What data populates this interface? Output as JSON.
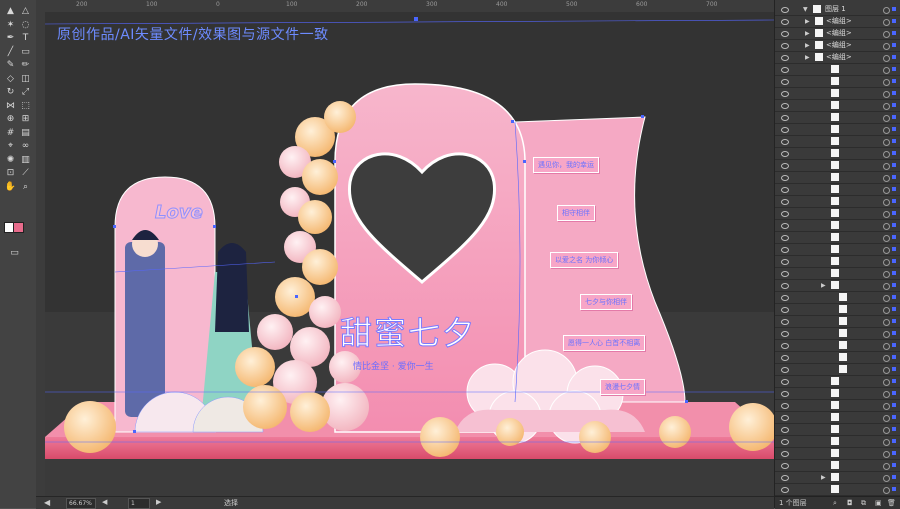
{
  "toolbar": {
    "tools": [
      {
        "name": "selection-tool",
        "glyph": "▲"
      },
      {
        "name": "direct-selection-tool",
        "glyph": "△"
      },
      {
        "name": "magic-wand-tool",
        "glyph": "✶"
      },
      {
        "name": "lasso-tool",
        "glyph": "◌"
      },
      {
        "name": "pen-tool",
        "glyph": "✒"
      },
      {
        "name": "type-tool",
        "glyph": "T"
      },
      {
        "name": "line-tool",
        "glyph": "╱"
      },
      {
        "name": "rectangle-tool",
        "glyph": "▭"
      },
      {
        "name": "paintbrush-tool",
        "glyph": "✎"
      },
      {
        "name": "pencil-tool",
        "glyph": "✏"
      },
      {
        "name": "shaper-tool",
        "glyph": "◇"
      },
      {
        "name": "eraser-tool",
        "glyph": "◫"
      },
      {
        "name": "rotate-tool",
        "glyph": "↻"
      },
      {
        "name": "scale-tool",
        "glyph": "⤢"
      },
      {
        "name": "width-tool",
        "glyph": "⋈"
      },
      {
        "name": "free-transform-tool",
        "glyph": "⬚"
      },
      {
        "name": "shape-builder-tool",
        "glyph": "⊕"
      },
      {
        "name": "perspective-grid-tool",
        "glyph": "⊞"
      },
      {
        "name": "mesh-tool",
        "glyph": "#"
      },
      {
        "name": "gradient-tool",
        "glyph": "▤"
      },
      {
        "name": "eyedropper-tool",
        "glyph": "⌖"
      },
      {
        "name": "blend-tool",
        "glyph": "∞"
      },
      {
        "name": "symbol-sprayer-tool",
        "glyph": "✺"
      },
      {
        "name": "column-graph-tool",
        "glyph": "▥"
      },
      {
        "name": "artboard-tool",
        "glyph": "⊡"
      },
      {
        "name": "slice-tool",
        "glyph": "⟋"
      },
      {
        "name": "hand-tool",
        "glyph": "✋"
      },
      {
        "name": "zoom-tool",
        "glyph": "⌕"
      }
    ],
    "fill_color": "#ffffff",
    "stroke_color": "#000000"
  },
  "watermark": "原创作品/AI矢量文件/效果图与源文件一致",
  "artwork": {
    "love_text": "Love",
    "title": "甜蜜七夕",
    "subtitle": "情比金坚 · 爱你一生"
  },
  "bubbles": [
    "遇见你，我的幸运",
    "相守相伴",
    "以爱之名 为你倾心",
    "七夕与你相伴",
    "愿得一人心 白首不相离",
    "浪漫七夕情"
  ],
  "status": {
    "zoom": "66.67%",
    "page": "1",
    "mode": "选择"
  },
  "layers": {
    "top_layer": "图层 1",
    "group_label": "<编组>",
    "footer_count": "1 个图层"
  },
  "colors": {
    "accent": "#4a66ff",
    "pink": "#f09bbd",
    "hot_pink": "#e8526f"
  }
}
